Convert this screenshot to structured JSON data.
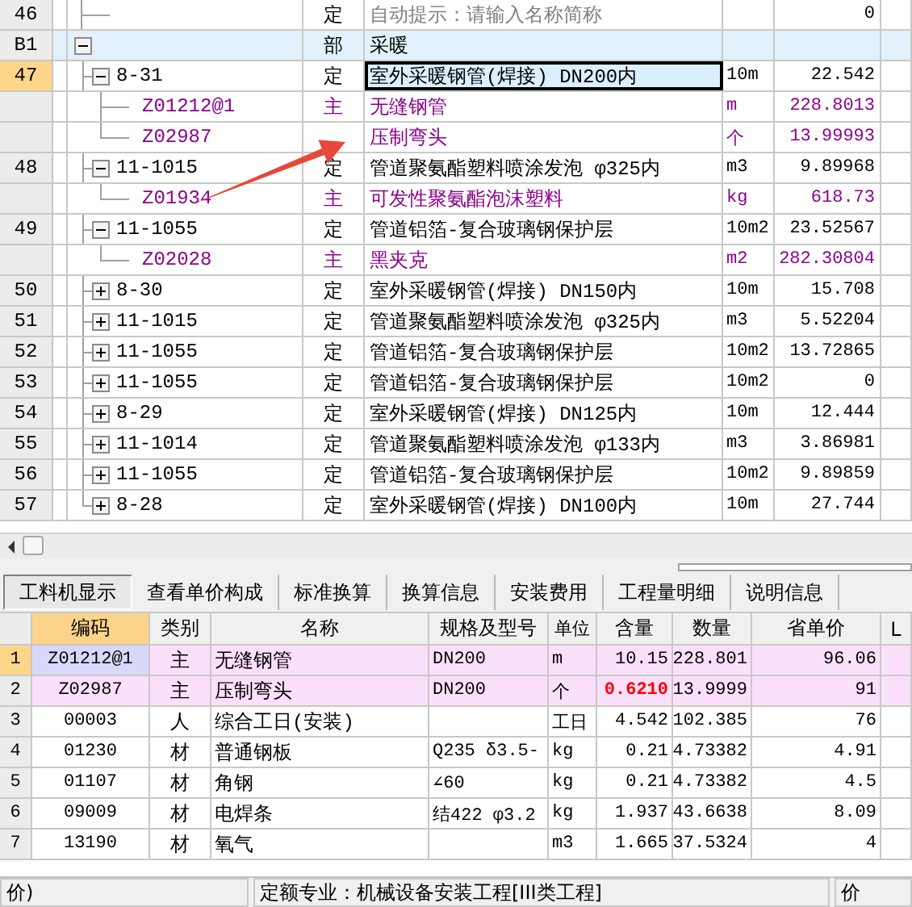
{
  "upper_grid": {
    "rows": [
      {
        "row_no": "46",
        "kind": "hint",
        "type": "定",
        "name": "自动提示：请输入名称简称",
        "value": "0",
        "selected": false
      },
      {
        "row_no": "B1",
        "kind": "section",
        "type": "部",
        "name": "采暖",
        "expanded": true,
        "selected": false,
        "children": [
          {
            "row_no": "47",
            "kind": "quota",
            "code": "8-31",
            "type": "定",
            "name": "室外采暖钢管(焊接) DN200内",
            "unit": "10m",
            "value": "22.542",
            "expanded": true,
            "selected": true,
            "children": [
              {
                "kind": "material",
                "code": "Z01212@1",
                "type": "主",
                "name": "无缝钢管",
                "unit": "m",
                "value": "228.8013",
                "selected": false
              },
              {
                "kind": "material",
                "code": "Z02987",
                "name": "压制弯头",
                "unit": "个",
                "value": "13.99993",
                "selected": false
              }
            ]
          },
          {
            "row_no": "48",
            "kind": "quota",
            "code": "11-1015",
            "type": "定",
            "name": "管道聚氨酯塑料喷涂发泡 φ325内",
            "unit": "m3",
            "value": "9.89968",
            "expanded": true,
            "selected": false,
            "children": [
              {
                "kind": "material",
                "code": "Z01934",
                "type": "主",
                "name": "可发性聚氨酯泡沫塑料",
                "unit": "kg",
                "value": "618.73",
                "selected": false
              }
            ]
          },
          {
            "row_no": "49",
            "kind": "quota",
            "code": "11-1055",
            "type": "定",
            "name": "管道铝箔-复合玻璃钢保护层",
            "unit": "10m2",
            "value": "23.52567",
            "expanded": true,
            "selected": false,
            "children": [
              {
                "kind": "material",
                "code": "Z02028",
                "type": "主",
                "name": "黑夹克",
                "unit": "m2",
                "value": "282.30804",
                "selected": false
              }
            ]
          },
          {
            "row_no": "50",
            "kind": "quota",
            "code": "8-30",
            "type": "定",
            "name": "室外采暖钢管(焊接) DN150内",
            "unit": "10m",
            "value": "15.708",
            "expanded": false,
            "selected": false
          },
          {
            "row_no": "51",
            "kind": "quota",
            "code": "11-1015",
            "type": "定",
            "name": "管道聚氨酯塑料喷涂发泡 φ325内",
            "unit": "m3",
            "value": "5.52204",
            "expanded": false,
            "selected": false
          },
          {
            "row_no": "52",
            "kind": "quota",
            "code": "11-1055",
            "type": "定",
            "name": "管道铝箔-复合玻璃钢保护层",
            "unit": "10m2",
            "value": "13.72865",
            "expanded": false,
            "selected": false
          },
          {
            "row_no": "53",
            "kind": "quota",
            "code": "11-1055",
            "type": "定",
            "name": "管道铝箔-复合玻璃钢保护层",
            "unit": "10m2",
            "value": "0",
            "expanded": false,
            "selected": false
          },
          {
            "row_no": "54",
            "kind": "quota",
            "code": "8-29",
            "type": "定",
            "name": "室外采暖钢管(焊接) DN125内",
            "unit": "10m",
            "value": "12.444",
            "expanded": false,
            "selected": false
          },
          {
            "row_no": "55",
            "kind": "quota",
            "code": "11-1014",
            "type": "定",
            "name": "管道聚氨酯塑料喷涂发泡 φ133内",
            "unit": "m3",
            "value": "3.86981",
            "expanded": false,
            "selected": false
          },
          {
            "row_no": "56",
            "kind": "quota",
            "code": "11-1055",
            "type": "定",
            "name": "管道铝箔-复合玻璃钢保护层",
            "unit": "10m2",
            "value": "9.89859",
            "expanded": false,
            "selected": false
          },
          {
            "row_no": "57",
            "kind": "quota",
            "code": "8-28",
            "type": "定",
            "name": "室外采暖钢管(焊接) DN100内",
            "unit": "10m",
            "value": "27.744",
            "expanded": false,
            "selected": false
          }
        ]
      }
    ]
  },
  "tabs": [
    {
      "label": "工料机显示",
      "selected": true
    },
    {
      "label": "查看单价构成",
      "selected": false
    },
    {
      "label": "标准换算",
      "selected": false
    },
    {
      "label": "换算信息",
      "selected": false
    },
    {
      "label": "安装费用",
      "selected": false
    },
    {
      "label": "工程量明细",
      "selected": false
    },
    {
      "label": "说明信息",
      "selected": false
    }
  ],
  "lower_grid": {
    "columns": [
      {
        "label": "编码",
        "selected": true
      },
      {
        "label": "类别",
        "selected": false
      },
      {
        "label": "名称",
        "selected": false
      },
      {
        "label": "规格及型号",
        "selected": false
      },
      {
        "label": "单位",
        "selected": false
      },
      {
        "label": "含量",
        "selected": false
      },
      {
        "label": "数量",
        "selected": false
      },
      {
        "label": "省单价",
        "selected": false
      },
      {
        "label": "L",
        "selected": false
      }
    ],
    "rows": [
      {
        "index": "1",
        "code": "Z01212@1",
        "type": "主",
        "name": "无缝钢管",
        "spec": "DN200",
        "unit": "m",
        "content": "10.15",
        "quantity": "228.801",
        "price": "96.06",
        "kind": "main",
        "selected": true,
        "content_modified": false
      },
      {
        "index": "2",
        "code": "Z02987",
        "type": "主",
        "name": "压制弯头",
        "spec": "DN200",
        "unit": "个",
        "content": "0.6210",
        "quantity": "13.9999",
        "price": "91",
        "kind": "main",
        "selected": false,
        "content_modified": true
      },
      {
        "index": "3",
        "code": "00003",
        "type": "人",
        "name": "综合工日(安装)",
        "unit": "工日",
        "content": "4.542",
        "quantity": "102.385",
        "price": "76",
        "kind": "normal",
        "selected": false,
        "content_modified": false
      },
      {
        "index": "4",
        "code": "01230",
        "type": "材",
        "name": "普通钢板",
        "spec": "Q235 δ3.5-",
        "unit": "kg",
        "content": "0.21",
        "quantity": "4.73382",
        "price": "4.91",
        "kind": "normal",
        "selected": false,
        "content_modified": false
      },
      {
        "index": "5",
        "code": "01107",
        "type": "材",
        "name": "角钢",
        "spec": "∠60",
        "unit": "kg",
        "content": "0.21",
        "quantity": "4.73382",
        "price": "4.5",
        "kind": "normal",
        "selected": false,
        "content_modified": false
      },
      {
        "index": "6",
        "code": "09009",
        "type": "材",
        "name": "电焊条",
        "spec": "结422 φ3.2",
        "unit": "kg",
        "content": "1.937",
        "quantity": "43.6638",
        "price": "8.09",
        "kind": "normal",
        "selected": false,
        "content_modified": false
      },
      {
        "index": "7",
        "code": "13190",
        "type": "材",
        "name": "氧气",
        "unit": "m3",
        "content": "1.665",
        "quantity": "37.5324",
        "price": "4",
        "kind": "normal",
        "selected": false,
        "content_modified": false
      }
    ]
  },
  "status_bar": [
    "价)",
    "定额专业：机械设备安装工程[III类工程]",
    "价"
  ]
}
